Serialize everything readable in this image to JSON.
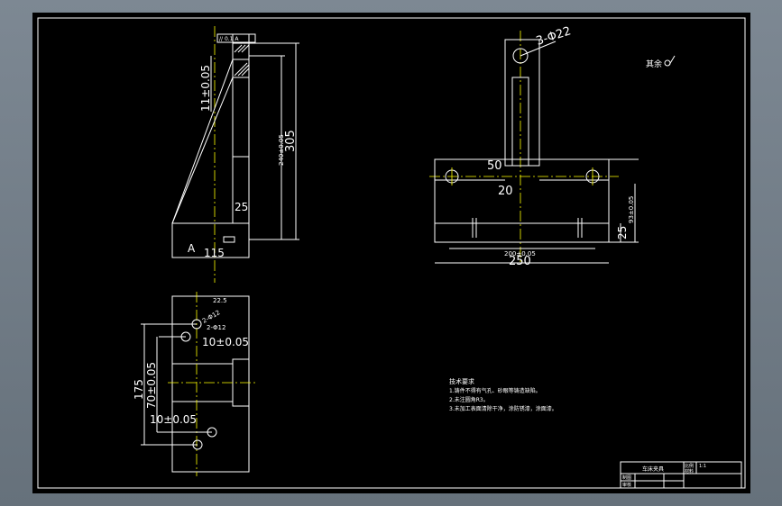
{
  "drawing": {
    "side_view": {
      "dim_height": "305",
      "dim_inner": "240±0.05",
      "dim_tol": "11±0.05",
      "dim_base_thk": "25",
      "dim_width": "115",
      "callout_a": "A",
      "gdt": "// 0.1 A"
    },
    "plan_view": {
      "dim_top": "22.5",
      "hole_callout": "2-Φ12",
      "hole_callout2": "2-Φ12",
      "dim_offset_top": "10±0.05",
      "dim_offset_bottom": "10±0.05",
      "dim_total": "175",
      "dim_inner": "70±0.05"
    },
    "front_view": {
      "hole_callout": "3-Φ22",
      "dim_width": "250",
      "dim_inner": "200±0.05",
      "dim_height": "93±0.05",
      "dim_base": "25",
      "dim_post": "50",
      "dim_20": "20"
    },
    "surface_note": "其余",
    "tech_notes": {
      "title": "技术要求",
      "items": [
        "1.铸件不得有气孔、砂眼等铸造缺陷。",
        "2.未注圆角R3。",
        "3.未加工表面清除干净，涂防锈漆，涂面漆。"
      ]
    },
    "title_block": {
      "part_name": "车床夹具",
      "label_scale": "比例",
      "label_material": "材料",
      "label_drawn": "制图",
      "label_checked": "审核",
      "scale_value": "1:1"
    }
  }
}
